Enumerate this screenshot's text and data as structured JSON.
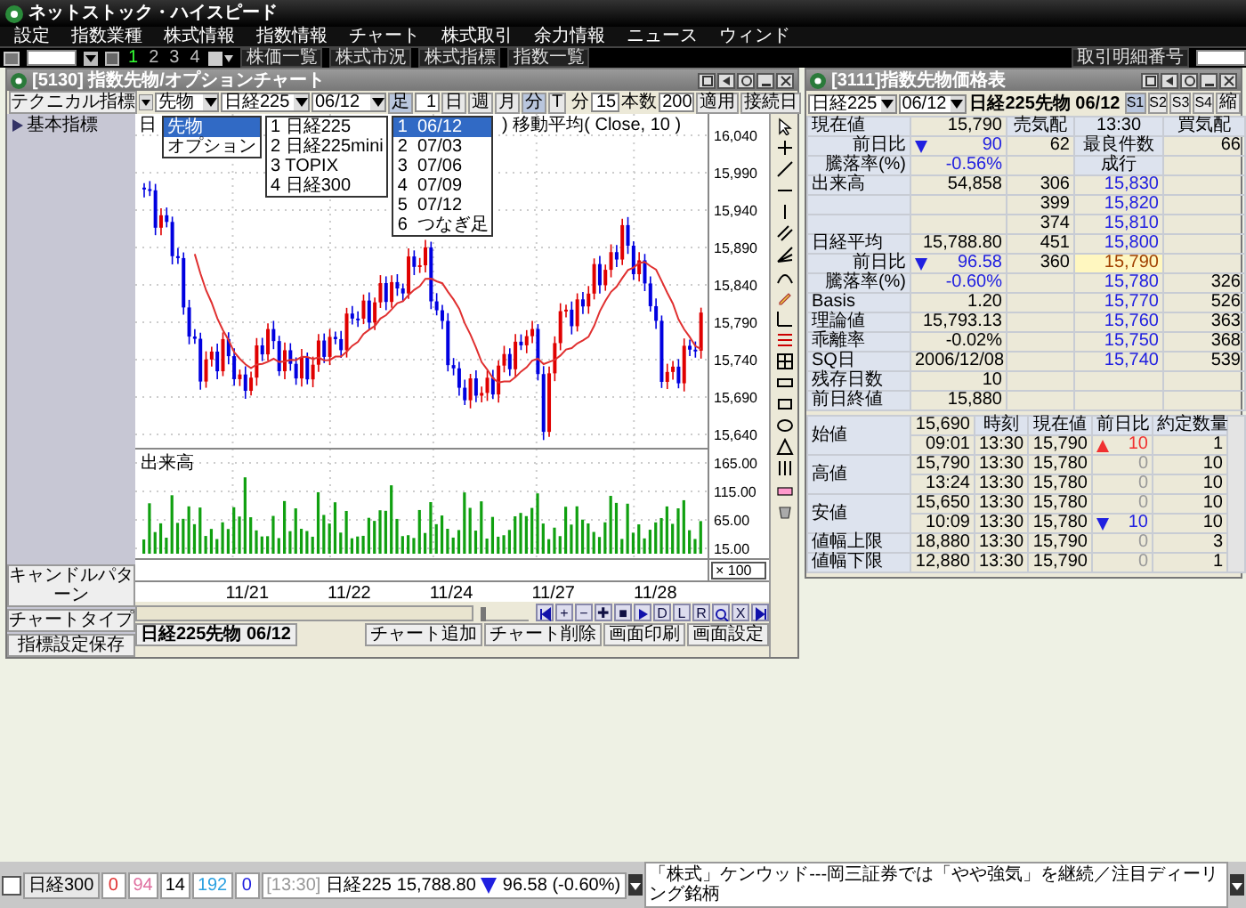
{
  "app_title": "ネットストック・ハイスピード",
  "menu": [
    "設定",
    "指数業種",
    "株式情報",
    "指数情報",
    "チャート",
    "株式取引",
    "余力情報",
    "ニュース",
    "ウィンド"
  ],
  "toolbar": {
    "pages": [
      {
        "label": "1",
        "selected": true
      },
      {
        "label": "2",
        "selected": false
      },
      {
        "label": "3",
        "selected": false
      },
      {
        "label": "4",
        "selected": false
      }
    ],
    "buttons": [
      "株価一覧",
      "株式市況",
      "株式指標",
      "指数一覧"
    ],
    "right_label": "取引明細番号"
  },
  "chart_window": {
    "title": "[5130] 指数先物/オプションチャート",
    "indicator_button": "テクニカル指標",
    "tree_items": [
      {
        "label": "基本指標",
        "expanded": false
      }
    ],
    "type_select": {
      "value": "先物",
      "options": [
        {
          "label": "先物",
          "selected": true
        },
        {
          "label": "オプション",
          "selected": false
        }
      ]
    },
    "index_select": {
      "value": "日経225",
      "options": [
        {
          "label": "1 日経225",
          "selected": false
        },
        {
          "label": "2 日経225mini",
          "selected": false
        },
        {
          "label": "3 TOPIX",
          "selected": false
        },
        {
          "label": "4 日経300",
          "selected": false
        }
      ]
    },
    "month_select": {
      "value": "06/12",
      "options": [
        {
          "label": "1  06/12",
          "selected": true
        },
        {
          "label": "2  07/03",
          "selected": false
        },
        {
          "label": "3  07/06",
          "selected": false
        },
        {
          "label": "4  07/09",
          "selected": false
        },
        {
          "label": "5  07/12",
          "selected": false
        },
        {
          "label": "6  つなぎ足",
          "selected": false
        }
      ]
    },
    "bar_label": "足",
    "bar_count": "1",
    "periods": [
      {
        "label": "日",
        "selected": false
      },
      {
        "label": "週",
        "selected": false
      },
      {
        "label": "月",
        "selected": false
      },
      {
        "label": "分",
        "selected": true
      },
      {
        "label": "T",
        "selected": false
      }
    ],
    "interval_label": "分",
    "interval": "15",
    "count_label": "本数",
    "count": "200",
    "apply_button": "適用",
    "link_button": "接続日",
    "legend_prefix": "日",
    "legend": ")   移動平均( Close, 10 )",
    "volume_label": "出来高",
    "price_ticks": [
      "16,040",
      "15,990",
      "15,940",
      "15,890",
      "15,840",
      "15,790",
      "15,740",
      "15,690",
      "15,640"
    ],
    "volume_ticks": [
      "165.00",
      "115.00",
      "65.00",
      "15.00"
    ],
    "volume_unit": "× 100",
    "dates": [
      "11/21",
      "11/22",
      "11/24",
      "11/27",
      "11/28"
    ],
    "zoom_slider": {
      "level": 0
    },
    "nav_buttons": [
      {
        "kind": "first"
      },
      {
        "kind": "text",
        "label": "+"
      },
      {
        "kind": "text",
        "label": "−"
      },
      {
        "kind": "text",
        "label": "✚"
      },
      {
        "kind": "text",
        "label": "■"
      },
      {
        "kind": "play"
      },
      {
        "kind": "text",
        "label": "D"
      },
      {
        "kind": "text",
        "label": "L"
      },
      {
        "kind": "text",
        "label": "R"
      },
      {
        "kind": "zoom"
      },
      {
        "kind": "text",
        "label": "X"
      },
      {
        "kind": "last"
      }
    ],
    "sidebar_buttons": [
      "キャンドルパターン",
      "チャートタイプ",
      "指標設定保存"
    ],
    "symbol_tab": "日経225先物 06/12",
    "bottom_buttons": [
      "チャート追加",
      "チャート削除",
      "画面印刷",
      "画面設定"
    ]
  },
  "board_window": {
    "title": "[3111]指数先物価格表",
    "index": "日経225",
    "month": "06/12",
    "name": "日経225先物 06/12",
    "views": [
      {
        "label": "S1",
        "selected": true
      },
      {
        "label": "S2",
        "selected": false
      },
      {
        "label": "S3",
        "selected": false
      },
      {
        "label": "S4",
        "selected": false
      },
      {
        "label": "縮",
        "selected": false
      }
    ],
    "info_rows": [
      {
        "kind": "plain",
        "label": "現在値",
        "value": "15,790"
      },
      {
        "kind": "fall",
        "label": "前日比",
        "indent": true,
        "arrow": true,
        "value": "90"
      },
      {
        "kind": "fall",
        "label": "騰落率(%)",
        "indent": true,
        "value": "-0.56%"
      },
      {
        "kind": "plain",
        "label": "出来高",
        "value": "54,858"
      },
      {
        "kind": "plain"
      },
      {
        "kind": "plain"
      },
      {
        "kind": "plain",
        "label": "日経平均",
        "value": "15,788.80"
      },
      {
        "kind": "fall",
        "label": "前日比",
        "indent": true,
        "arrow": true,
        "value": "96.58"
      },
      {
        "kind": "fall",
        "label": "騰落率(%)",
        "indent": true,
        "value": "-0.60%"
      },
      {
        "kind": "plain",
        "label": "Basis",
        "value": "1.20"
      },
      {
        "kind": "plain",
        "label": "理論値",
        "value": "15,793.13"
      },
      {
        "kind": "plain",
        "label": "乖離率",
        "value": "-0.02%"
      },
      {
        "kind": "plain",
        "label": "SQ日",
        "value": "2006/12/08"
      },
      {
        "kind": "plain",
        "label": "残存日数",
        "value": "10"
      },
      {
        "kind": "plain",
        "label": "前日終値",
        "value": "15,880"
      }
    ],
    "book": {
      "header": [
        "売気配",
        "13:30",
        "買気配"
      ],
      "best": {
        "sell": "62",
        "label": "最良件数",
        "buy": "66"
      },
      "market_label": "成行",
      "levels": [
        {
          "sell": "306",
          "price": "15,830",
          "current": false
        },
        {
          "sell": "399",
          "price": "15,820",
          "current": false
        },
        {
          "sell": "374",
          "price": "15,810",
          "current": false
        },
        {
          "sell": "451",
          "price": "15,800",
          "current": false
        },
        {
          "sell": "360",
          "price": "15,790",
          "current": true
        },
        {
          "price": "15,780",
          "buy": "326",
          "current": false
        },
        {
          "price": "15,770",
          "buy": "526",
          "current": false
        },
        {
          "price": "15,760",
          "buy": "363",
          "current": false
        },
        {
          "price": "15,750",
          "buy": "368",
          "current": false
        },
        {
          "price": "15,740",
          "buy": "539",
          "current": false
        }
      ]
    },
    "stats": [
      {
        "label": "始値",
        "values": [
          "15,690",
          "09:01"
        ]
      },
      {
        "label": "高値",
        "values": [
          "15,790",
          "13:24"
        ]
      },
      {
        "label": "安値",
        "values": [
          "15,650",
          "10:09"
        ]
      },
      {
        "label": "値幅上限",
        "values": [
          "18,880"
        ]
      },
      {
        "label": "値幅下限",
        "values": [
          "12,880"
        ]
      }
    ],
    "ticks": {
      "columns": [
        "時刻",
        "現在値",
        "前日比",
        "約定数量"
      ],
      "rows": [
        {
          "kind": "up",
          "time": "13:30",
          "price": "15,790",
          "change": "10",
          "qty": "1"
        },
        {
          "kind": "flat",
          "time": "13:30",
          "price": "15,780",
          "change": "0",
          "qty": "10"
        },
        {
          "kind": "flat",
          "time": "13:30",
          "price": "15,780",
          "change": "0",
          "qty": "10"
        },
        {
          "kind": "flat",
          "time": "13:30",
          "price": "15,780",
          "change": "0",
          "qty": "10"
        },
        {
          "kind": "down",
          "time": "13:30",
          "price": "15,780",
          "change": "10",
          "qty": "10"
        },
        {
          "kind": "flat",
          "time": "13:30",
          "price": "15,790",
          "change": "0",
          "qty": "3"
        },
        {
          "kind": "flat",
          "time": "13:30",
          "price": "15,790",
          "change": "0",
          "qty": "1"
        }
      ]
    }
  },
  "status_bar": {
    "checked": false,
    "index": "日経300",
    "counts": [
      {
        "value": "0",
        "color": "#e03030"
      },
      {
        "value": "94",
        "color": "#e070a0"
      },
      {
        "value": "14",
        "color": "#000000"
      },
      {
        "value": "192",
        "color": "#2aa0e0"
      },
      {
        "value": "0",
        "color": "#2020e0"
      }
    ],
    "time": "[13:30]",
    "name": "日経225",
    "price": "15,788.80",
    "kind": "down",
    "change": "96.58 (-0.60%)",
    "news": "「株式」ケンウッド---岡三証券では「やや強気」を継続／注目ディーリング銘柄"
  }
}
